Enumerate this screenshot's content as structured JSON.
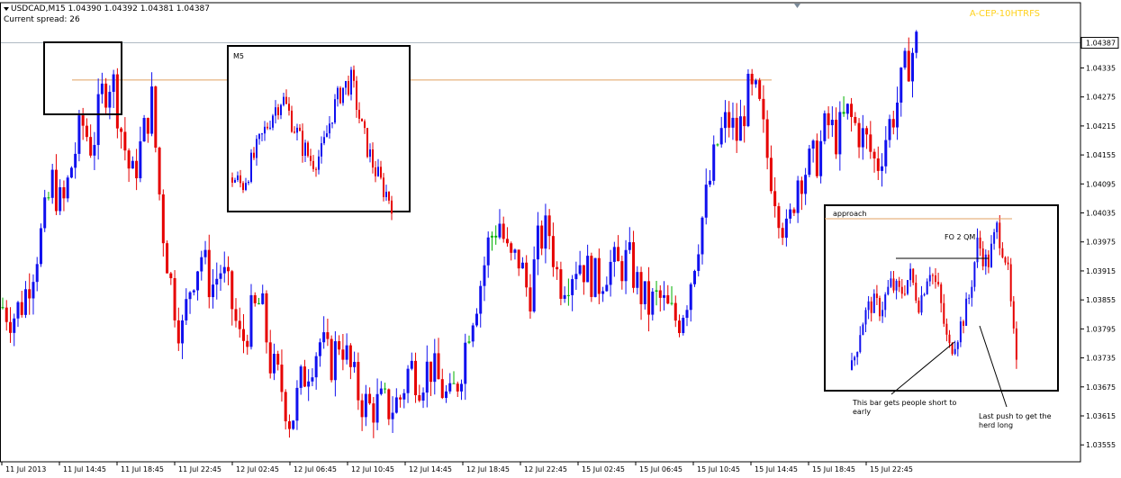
{
  "header": {
    "symbol_line": "USDCAD,M15  1.04390 1.04392 1.04381 1.04387",
    "spread_line": "Current spread: 26",
    "watermark": "A-CEP-10HTRFS"
  },
  "colors": {
    "bull": "#1010ee",
    "bear": "#e60000",
    "doji": "#00b000",
    "level_line": "#e0a060",
    "grid": "#c8c8c8",
    "axis": "#000000"
  },
  "annotations": {
    "m5_label": "M5",
    "approach_label": "approach",
    "fo_label": "FO 2 QM",
    "short_note": "This bar gets people short to early",
    "long_note": "Last push to get the herd long"
  },
  "chart_data": {
    "type": "candlestick",
    "title": "USDCAD,M15",
    "current_price": 1.04387,
    "ylim": [
      1.0352,
      1.0447
    ],
    "y_ticks": [
      "1.04387",
      "1.04335",
      "1.04275",
      "1.04215",
      "1.04155",
      "1.04095",
      "1.04035",
      "1.03975",
      "1.03915",
      "1.03855",
      "1.03795",
      "1.03735",
      "1.03675",
      "1.03615",
      "1.03555"
    ],
    "x_ticks": [
      "11 Jul 2013",
      "11 Jul 14:45",
      "11 Jul 18:45",
      "11 Jul 22:45",
      "12 Jul 02:45",
      "12 Jul 06:45",
      "12 Jul 10:45",
      "12 Jul 14:45",
      "12 Jul 18:45",
      "12 Jul 22:45",
      "15 Jul 02:45",
      "15 Jul 06:45",
      "15 Jul 10:45",
      "15 Jul 14:45",
      "15 Jul 18:45",
      "15 Jul 22:45"
    ],
    "level_price": 1.0431,
    "close_path": [
      1.0384,
      1.0382,
      1.0385,
      1.0392,
      1.04,
      1.041,
      1.0404,
      1.0414,
      1.0422,
      1.0417,
      1.0428,
      1.0432,
      1.042,
      1.041,
      1.0418,
      1.0427,
      1.0402,
      1.0388,
      1.0378,
      1.039,
      1.0395,
      1.0388,
      1.0392,
      1.0385,
      1.0376,
      1.0382,
      1.0385,
      1.0372,
      1.0368,
      1.036,
      1.0368,
      1.0373,
      1.0377,
      1.0372,
      1.0378,
      1.0371,
      1.0365,
      1.0363,
      1.0364,
      1.0363,
      1.0365,
      1.0372,
      1.0369,
      1.0372,
      1.0368,
      1.0364,
      1.037,
      1.0381,
      1.0388,
      1.0398,
      1.0402,
      1.0393,
      1.0394,
      1.0386,
      1.0398,
      1.04,
      1.0389,
      1.0391,
      1.0394,
      1.0391,
      1.0389,
      1.0393,
      1.0392,
      1.0394,
      1.0388,
      1.0384,
      1.0386,
      1.0383,
      1.0381,
      1.0387,
      1.0398,
      1.0408,
      1.0418,
      1.0423,
      1.0419,
      1.0428,
      1.0427,
      1.0415,
      1.0406,
      1.0398,
      1.0411,
      1.0413,
      1.0415,
      1.0422,
      1.0419,
      1.0424,
      1.0421,
      1.0418,
      1.0413,
      1.042,
      1.0426,
      1.0434,
      1.04387
    ]
  }
}
